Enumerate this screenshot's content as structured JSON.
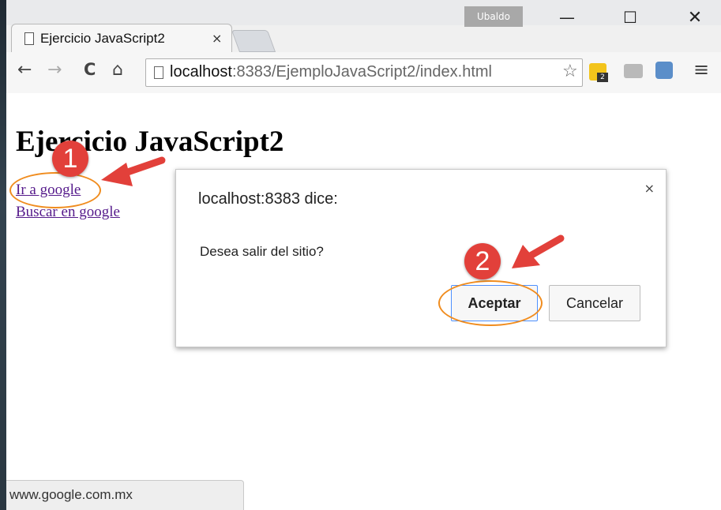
{
  "profile_name": "Ubaldo",
  "window_controls": {
    "minimize": "—",
    "maximize": "☐",
    "close": "✕"
  },
  "tab": {
    "title": "Ejercicio JavaScript2",
    "close": "×"
  },
  "toolbar": {
    "back": "←",
    "forward": "→",
    "reload": "C",
    "home": "⌂",
    "menu": "≡",
    "ext_badge": "2"
  },
  "address": {
    "host": "localhost",
    "rest": ":8383/EjemploJavaScript2/index.html"
  },
  "page": {
    "heading": "Ejercicio JavaScript2",
    "links": [
      "Ir a google",
      "Buscar en google"
    ]
  },
  "dialog": {
    "title": "localhost:8383 dice:",
    "close": "×",
    "message": "Desea salir del sitio?",
    "ok_label": "Aceptar",
    "cancel_label": "Cancelar"
  },
  "status_bar": "www.google.com.mx",
  "annotations": {
    "step1": "1",
    "step2": "2",
    "ring_color": "#f08c1e",
    "badge_color": "#e2403a"
  }
}
